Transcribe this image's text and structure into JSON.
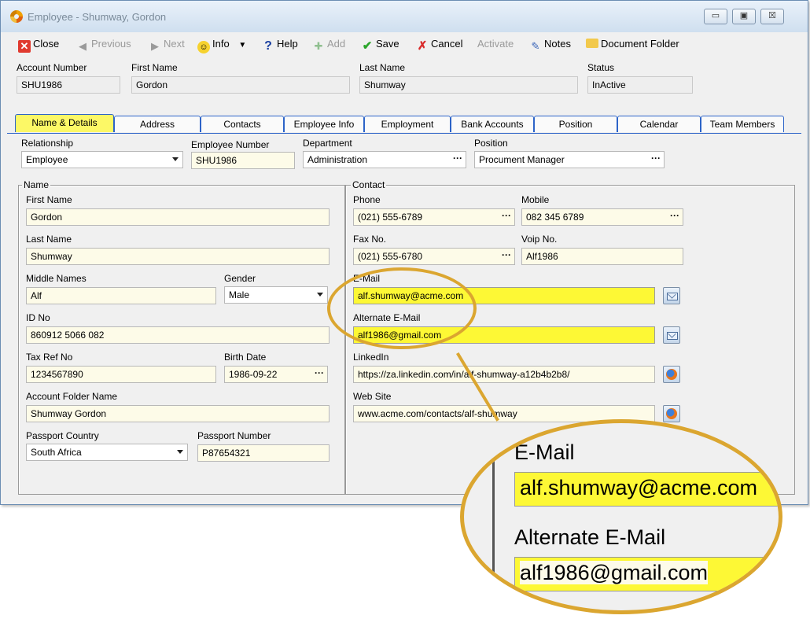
{
  "window": {
    "title": "Employee - Shumway, Gordon",
    "min": "▭",
    "max": "▣",
    "close": "☒"
  },
  "toolbar": {
    "close": "Close",
    "previous": "Previous",
    "next": "Next",
    "info": "Info",
    "help": "Help",
    "add": "Add",
    "save": "Save",
    "cancel": "Cancel",
    "activate": "Activate",
    "notes": "Notes",
    "document_folder": "Document Folder"
  },
  "header": {
    "account_number_label": "Account Number",
    "account_number": "SHU1986",
    "first_name_label": "First Name",
    "first_name": "Gordon",
    "last_name_label": "Last Name",
    "last_name": "Shumway",
    "status_label": "Status",
    "status": "InActive"
  },
  "tabs": [
    "Name & Details",
    "Address",
    "Contacts",
    "Employee Info",
    "Employment",
    "Bank Accounts",
    "Position",
    "Calendar",
    "Team Members"
  ],
  "details": {
    "relationship_label": "Relationship",
    "relationship": "Employee",
    "employee_number_label": "Employee Number",
    "employee_number": "SHU1986",
    "department_label": "Department",
    "department": "Administration",
    "position_label": "Position",
    "position": "Procument Manager"
  },
  "name_group": {
    "title": "Name",
    "first_name_label": "First Name",
    "first_name": "Gordon",
    "last_name_label": "Last Name",
    "last_name": "Shumway",
    "middle_names_label": "Middle Names",
    "middle_names": "Alf",
    "gender_label": "Gender",
    "gender": "Male",
    "id_no_label": "ID No",
    "id_no": "860912 5066 082",
    "tax_ref_label": "Tax Ref No",
    "tax_ref": "1234567890",
    "birth_date_label": "Birth Date",
    "birth_date": "1986-09-22",
    "folder_label": "Account Folder Name",
    "folder": "Shumway Gordon",
    "passport_country_label": "Passport Country",
    "passport_country": "South Africa",
    "passport_number_label": "Passport Number",
    "passport_number": "P87654321"
  },
  "contact_group": {
    "title": "Contact",
    "phone_label": "Phone",
    "phone": "(021) 555-6789",
    "mobile_label": "Mobile",
    "mobile": "082 345 6789",
    "fax_label": "Fax No.",
    "fax": "(021) 555-6780",
    "voip_label": "Voip No.",
    "voip": "Alf1986",
    "email_label": "E-Mail",
    "email": "alf.shumway@acme.com",
    "alt_email_label": "Alternate E-Mail",
    "alt_email": "alf1986@gmail.com",
    "linkedin_label": "LinkedIn",
    "linkedin": "https://za.linkedin.com/in/alf-shumway-a12b4b2b8/",
    "website_label": "Web Site",
    "website": "www.acme.com/contacts/alf-shumway"
  },
  "zoom": {
    "email_label": "E-Mail",
    "email": "alf.shumway@acme.com",
    "alt_email_label": "Alternate E-Mail",
    "alt_email": "alf1986@gmail.com"
  },
  "colors": {
    "highlight": "#fdf835",
    "accent_ring": "#dba630",
    "tab_active": "#fcf866"
  }
}
